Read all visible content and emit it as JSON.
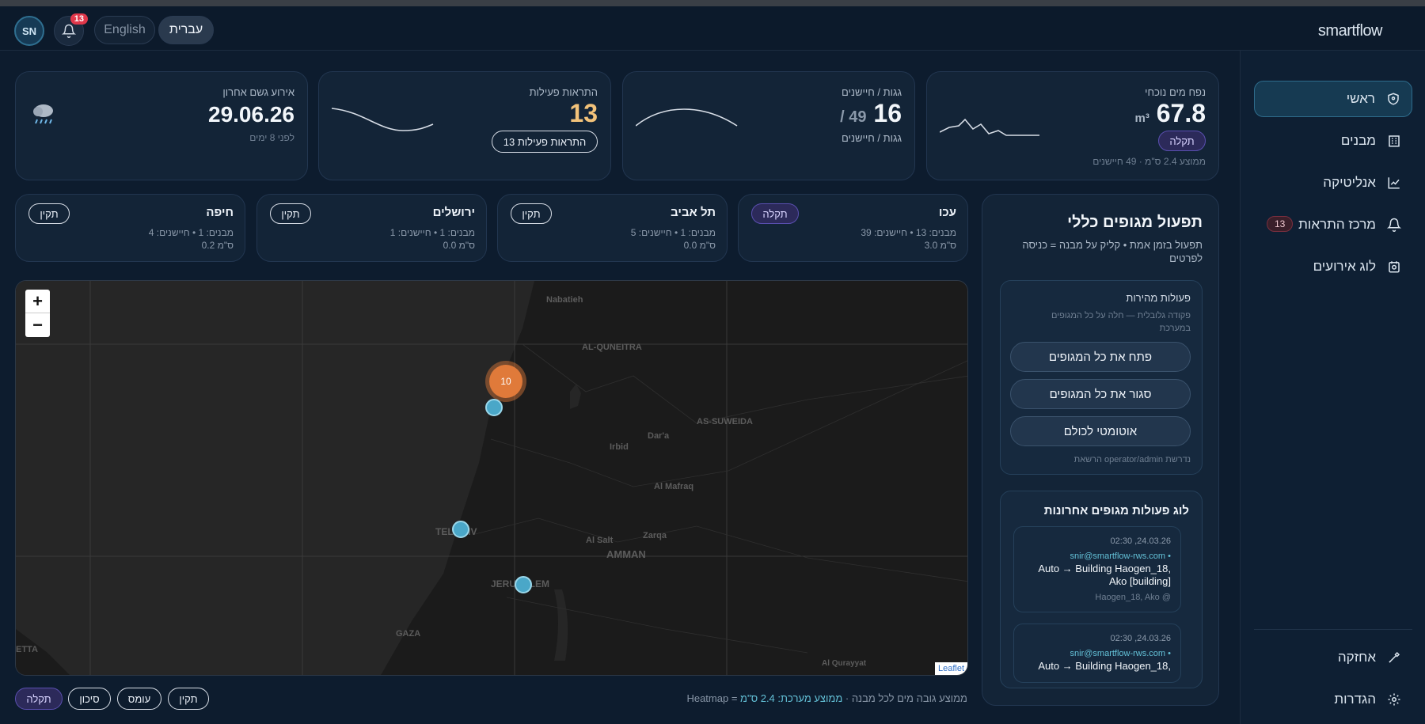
{
  "header": {
    "avatar_initials": "SN",
    "notifications_count": "13",
    "lang_english": "English",
    "lang_hebrew": "עברית",
    "logo": "smartflow"
  },
  "sidebar": {
    "items": [
      {
        "label": "ראשי",
        "icon": "shield-icon"
      },
      {
        "label": "מבנים",
        "icon": "building-icon"
      },
      {
        "label": "אנליטיקה",
        "icon": "chart-icon"
      },
      {
        "label": "מרכז התראות",
        "icon": "bell-icon",
        "count": "13"
      },
      {
        "label": "לוג אירועים",
        "icon": "log-icon"
      }
    ],
    "bottom": [
      {
        "label": "אחזקה",
        "icon": "wrench-icon"
      },
      {
        "label": "הגדרות",
        "icon": "gear-icon"
      }
    ]
  },
  "kpis": {
    "volume": {
      "label": "נפח מים נוכחי",
      "value": "67.8",
      "unit": "m³",
      "status": "תקלה",
      "sub": "ממוצע 2.4 ס\"מ · 49 חיישנים"
    },
    "roofs": {
      "label": "גגות / חיישנים",
      "value": "16",
      "secondary": "49 /",
      "sub": "גגות / חיישנים"
    },
    "alerts": {
      "label": "התראות פעילות",
      "value": "13",
      "button": "13 התראות פעילות"
    },
    "rain": {
      "label": "אירוע גשם אחרון",
      "value": "29.06.26",
      "sub": "לפני 8 ימים",
      "icon": "rain-cloud-icon"
    }
  },
  "cities": [
    {
      "name": "עכו",
      "meta1": "מבנים: 13 • חיישנים: 39",
      "meta2": "3.0 ס\"מ",
      "status": "תקלה",
      "status_kind": "fault"
    },
    {
      "name": "תל אביב",
      "meta1": "מבנים: 1 • חיישנים: 5",
      "meta2": "0.0 ס\"מ",
      "status": "תקין",
      "status_kind": "ok"
    },
    {
      "name": "ירושלים",
      "meta1": "מבנים: 1 • חיישנים: 1",
      "meta2": "0.0 ס\"מ",
      "status": "תקין",
      "status_kind": "ok"
    },
    {
      "name": "חיפה",
      "meta1": "מבנים: 1 • חיישנים: 4",
      "meta2": "0.2 ס\"מ",
      "status": "תקין",
      "status_kind": "ok"
    }
  ],
  "map": {
    "zoom_in": "+",
    "zoom_out": "−",
    "cluster_count": "10",
    "labels": [
      "Nabatieh",
      "AL-QUNEITRA",
      "AS-SUWEIDA",
      "Irbid",
      "Dar'a",
      "Al Mafraq",
      "Al Salt",
      "Zarqa",
      "AMMAN",
      "TEL AVIV",
      "JERUSALEM",
      "GAZA",
      "Al Qurayyat",
      "ETTA"
    ],
    "attribution": "Leaflet"
  },
  "legend": {
    "note_prefix": "Heatmap = ממוצע גובה מים לכל מבנה · ",
    "note_avg": "ממוצע מערכת: 2.4 ס\"מ",
    "items": [
      "תקין",
      "עומס",
      "סיכון",
      "תקלה"
    ]
  },
  "control_panel": {
    "title": "תפעול מגופים כללי",
    "subtitle": "תפעול בזמן אמת • קליק על מבנה = כניסה לפרטים",
    "quick": {
      "title": "פעולות מהירות",
      "desc": "פקודה גלובלית — חלה על כל המגופים במערכת",
      "open_all": "פתח את כל המגופים",
      "close_all": "סגור את כל המגופים",
      "auto_all": "אוטומטי לכולם",
      "permission": "הרשאת operator/admin נדרשת"
    },
    "log": {
      "title": "לוג פעולות מגופים אחרונות",
      "entries": [
        {
          "time": "02:30 ,24.03.26",
          "user": "snir@smartflow-rws.com •",
          "msg": "Auto → Building Haogen_18, Ako [building]",
          "sub": "Haogen_18, Ako @"
        },
        {
          "time": "02:30 ,24.03.26",
          "user": "snir@smartflow-rws.com •",
          "msg": "Auto → Building Haogen_18,",
          "sub": ""
        }
      ]
    }
  },
  "colors": {
    "accent": "#63c0d6",
    "fault": "#5a4fb0",
    "alerts_value": "#f2c27a",
    "bg": "#0d1c2e"
  }
}
